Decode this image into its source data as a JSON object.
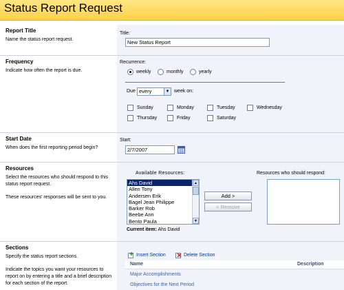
{
  "page": {
    "title": "Status Report Request"
  },
  "sections": {
    "report_title": {
      "heading": "Report Title",
      "description": "Name the status report request.",
      "field_label": "Title:",
      "field_value": "New Status Report"
    },
    "frequency": {
      "heading": "Frequency",
      "description": "Indicate how often the report is due.",
      "recurrence_label": "Recurrence:",
      "options": [
        "weekly",
        "monthly",
        "yearly"
      ],
      "selected": "weekly",
      "due_label": "Due",
      "due_value": "every",
      "week_on_label": "week on:",
      "days": [
        "Sunday",
        "Monday",
        "Tuesday",
        "Wednesday",
        "Thursday",
        "Friday",
        "Saturday"
      ]
    },
    "start_date": {
      "heading": "Start Date",
      "description": "When does the first reporting period begin?",
      "field_label": "Start:",
      "field_value": "2/7/2007"
    },
    "resources": {
      "heading": "Resources",
      "description_1": "Select the resources who should respond to this status report request.",
      "description_2": "These resources' responses will be sent to you.",
      "available_label": "Available Resources:",
      "respond_label": "Resources who should respond:",
      "available": [
        "Ahs David",
        "Allen Tony",
        "Andersen Erik",
        "Bagel Jean Philippe",
        "Barker Rob",
        "Beebe Ann",
        "Bento Paula"
      ],
      "selected_item": "Ahs David",
      "add_label": "Add >",
      "remove_label": "< Remove",
      "current_item_label": "Current item:",
      "current_item_value": "Ahs David"
    },
    "sections": {
      "heading": "Sections",
      "description_1": "Specify the status report sections.",
      "description_2": "Indicate the topics you want your resources to report on by entering a title and a brief description for each section of the report.",
      "insert_label": "Insert Section",
      "delete_label": "Delete Section",
      "col_name": "Name",
      "col_description": "Description",
      "rows": [
        "Major Accomplishments",
        "Objectives for the Next Period"
      ]
    }
  }
}
